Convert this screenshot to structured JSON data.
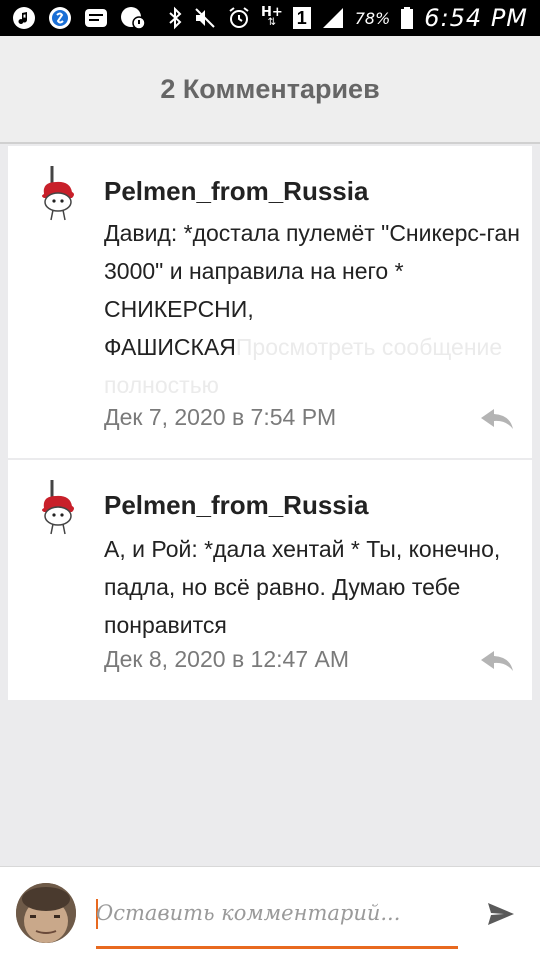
{
  "status_bar": {
    "battery": "78%",
    "time": "6:54 PM",
    "network_label": "H+",
    "sim_slot": "1",
    "icons": [
      "music-icon",
      "shazam-icon",
      "messages-icon",
      "hangouts-icon",
      "bluetooth-icon",
      "mute-icon",
      "alarm-icon",
      "network-icon",
      "signal-icon",
      "battery-icon"
    ]
  },
  "header": {
    "title": "2 Комментариев"
  },
  "comments": [
    {
      "author": "Pelmen_from_Russia",
      "text": "Давид: *достала пулемёт \"Сникерс-ган 3000\" и направила на него * СНИКЕРСНИ, ФАШИСКАЯ",
      "more_link": "Просмотреть сообщение полностью",
      "date": "Дек 7, 2020 в 7:54 PM"
    },
    {
      "author": "Pelmen_from_Russia",
      "text": "А, и Рой: *дала хентай * Ты, конечно, падла, но всё равно. Думаю тебе понравится",
      "date": "Дек 8, 2020 в 12:47 AM"
    }
  ],
  "composer": {
    "placeholder": "Оставить комментарий..."
  },
  "colors": {
    "accent": "#e8691f",
    "background": "#ebebed",
    "card": "#ffffff",
    "header_text": "#666666",
    "date_text": "#7a7a7a"
  }
}
